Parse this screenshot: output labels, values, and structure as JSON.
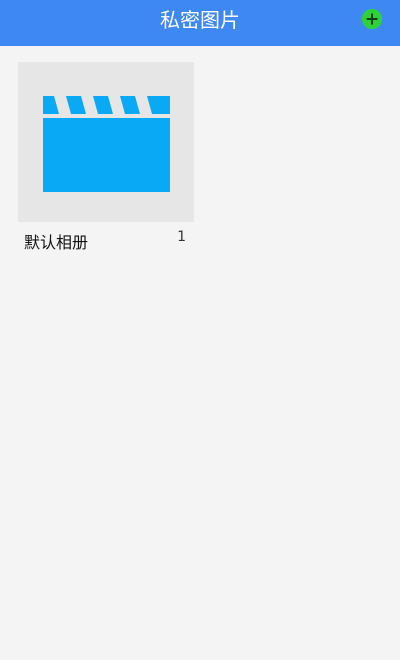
{
  "header": {
    "title": "私密图片",
    "add_icon": "plus-circle-icon"
  },
  "albums": [
    {
      "name": "默认相册",
      "count": "1",
      "thumbnail_icon": "clapperboard-icon"
    }
  ],
  "colors": {
    "header_bg": "#3d88f2",
    "add_button": "#2fd13a",
    "thumbnail_icon": "#0aa9f5",
    "thumbnail_bg": "#e6e6e6",
    "page_bg": "#f4f4f4"
  }
}
